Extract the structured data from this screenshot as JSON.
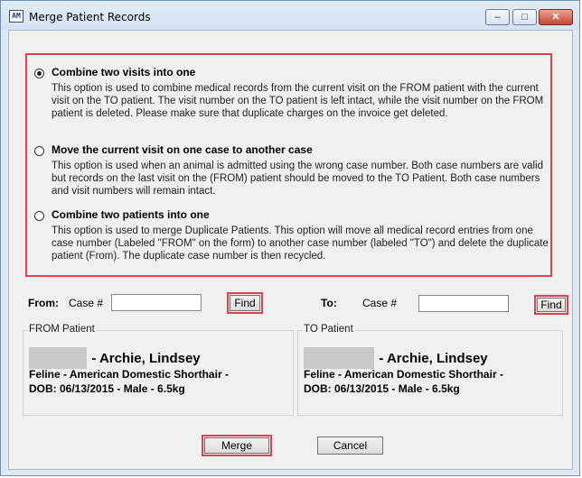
{
  "window": {
    "title": "Merge Patient Records",
    "icon_text": "AM",
    "controls": {
      "minimize": "–",
      "maximize": "□",
      "close": "✕"
    }
  },
  "options": [
    {
      "label": "Combine two visits into one",
      "selected": true,
      "description": "This option is used to combine medical records from the current visit on the FROM patient with the current visit on the TO patient. The visit number on the TO patient is left intact, while the visit number on the FROM patient is deleted.  Please make sure that duplicate charges on the invoice get deleted."
    },
    {
      "label": "Move the current visit on one case to another case",
      "selected": false,
      "description": "This option is used when an animal is admitted using the wrong case number.  Both case numbers are valid but records on the last visit on the (FROM) patient should be moved to the TO Patient.  Both case numbers and visit numbers will remain intact."
    },
    {
      "label": "Combine two patients into one",
      "selected": false,
      "description": "This option is used to merge Duplicate Patients.  This option will move all medical record entries from one case number (Labeled \"FROM\" on the form) to another case number (labeled \"TO\") and delete the duplicate patient (From).  The duplicate case number is then recycled."
    }
  ],
  "from": {
    "label": "From:",
    "case_label": "Case #",
    "case_value": "",
    "find_label": "Find"
  },
  "to": {
    "label": "To:",
    "case_label": "Case #",
    "case_value": "",
    "find_label": "Find"
  },
  "from_patient": {
    "group_title": "FROM Patient",
    "name": "- Archie, Lindsey",
    "species_breed": "Feline - American Domestic Shorthair -",
    "details": "DOB: 06/13/2015 - Male - 6.5kg"
  },
  "to_patient": {
    "group_title": "TO Patient",
    "name": "- Archie, Lindsey",
    "species_breed": "Feline - American Domestic Shorthair -",
    "details": "DOB: 06/13/2015 - Male - 6.5kg"
  },
  "buttons": {
    "merge": "Merge",
    "cancel": "Cancel"
  },
  "colors": {
    "highlight": "#e0404f",
    "dialog_bg": "#f0f0f0"
  }
}
